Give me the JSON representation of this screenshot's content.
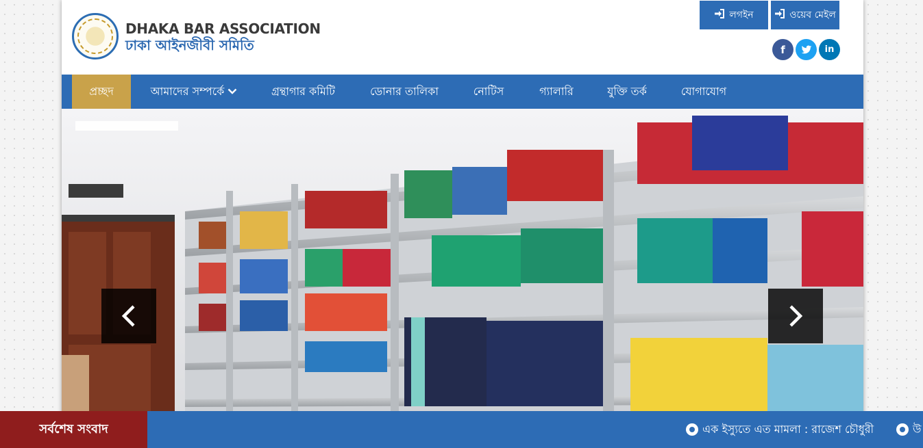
{
  "brand": {
    "name_en": "DHAKA BAR ASSOCIATION",
    "name_bn": "ঢাকা আইনজীবী সমিতি",
    "logo_icon": "association-seal-logo"
  },
  "header": {
    "login_label": "লগইন",
    "webmail_label": "ওয়েব মেইল",
    "login_icon": "sign-in-icon",
    "webmail_icon": "sign-in-icon",
    "social": [
      "facebook",
      "twitter",
      "linkedin"
    ]
  },
  "nav": {
    "items": [
      {
        "label": "প্রচ্ছদ",
        "active": true
      },
      {
        "label": "আমাদের সম্পর্কে",
        "has_dropdown": true
      },
      {
        "label": "গ্রন্থাগার কমিটি"
      },
      {
        "label": "ডোনার তালিকা"
      },
      {
        "label": "নোটিস"
      },
      {
        "label": "গ্যালারি"
      },
      {
        "label": "যুক্তি তর্ক"
      },
      {
        "label": "যোগাযোগ"
      }
    ]
  },
  "slider": {
    "image_icon": "library-bookshelves-photo",
    "prev_icon": "chevron-left-icon",
    "next_icon": "chevron-right-icon"
  },
  "ticker": {
    "label": "সর্বশেষ সংবাদ",
    "items": [
      "এক ইস্যুতে এত মামলা : রাজেশ চৌধুরী",
      "উ"
    ]
  },
  "colors": {
    "primary": "#2d6cb5",
    "nav_active": "#c9a24a",
    "ticker_label_bg": "#8f1d1d",
    "facebook": "#3b5998",
    "twitter": "#1da1f2",
    "linkedin": "#0077b5"
  }
}
